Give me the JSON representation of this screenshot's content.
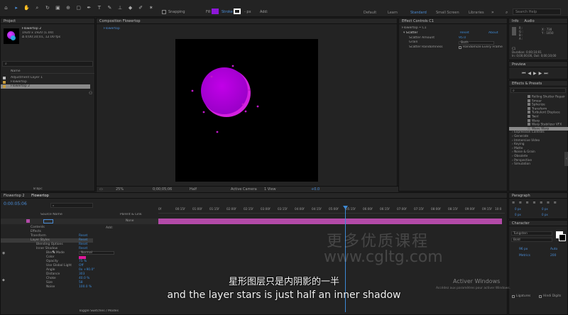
{
  "toolbar": {
    "snapping": "Snapping",
    "fill_label": "Fill",
    "stroke_label": "Stroke",
    "stroke_px": "- px",
    "add_label": "Add:",
    "workspaces": [
      "Default",
      "Learn",
      "Standard",
      "Small Screen",
      "Libraries"
    ],
    "search_placeholder": "Search Help"
  },
  "project": {
    "title": "Project",
    "thumb_name": "Flowertop 2",
    "thumb_info1": "1920 x 1920 (1.00)",
    "thumb_info2": "Δ 0;00;10;01, 12.00 fps",
    "col_name": "Name",
    "items": [
      "Adjustment Layer 1",
      "Flowertop",
      "Flowertop 2"
    ],
    "bpc": "8 bpc"
  },
  "composition": {
    "tab_title": "Composition Flowertop",
    "breadcrumb": "Flowertop",
    "zoom": "25%",
    "timecode": "0;00;05;06",
    "resolution": "Half",
    "camera": "Active Camera",
    "views": "1 View",
    "exposure": "+0.0"
  },
  "effect_controls": {
    "title": "Effect Controls C1",
    "layer": "Flowertop • C1",
    "fx_name": "Scatter",
    "reset": "Reset",
    "about": "About",
    "params": [
      {
        "label": "Scatter Amount",
        "value": "95.0"
      },
      {
        "label": "Grain",
        "value": "Both"
      },
      {
        "label": "Scatter Randomness",
        "value": "Randomize Every Frame"
      }
    ]
  },
  "info": {
    "tabs": [
      "Info",
      "Audio"
    ],
    "rgb": [
      "R :",
      "G :",
      "B :",
      "A :"
    ],
    "xy": [
      "X : 730",
      "Y : 1050"
    ],
    "layer_name": "C1",
    "duration": "Duration: 0;00;10;01",
    "in": "In: 0;00;00;00, Out: 0;00;10;00"
  },
  "preview": {
    "title": "Preview"
  },
  "effects_presets": {
    "title": "Effects & Presets",
    "items": [
      "Rolling Shutter Repair",
      "Smear",
      "Spherize",
      "Transform",
      "Turbulent Displace",
      "Twirl",
      "Warp",
      "Warp Stabilizer VFX",
      "Wave Warp"
    ],
    "categories": [
      "Expression Controls",
      "Generate",
      "Immersive Video",
      "Keying",
      "Matte",
      "Noise & Grain",
      "Obsolete",
      "Perspective",
      "Simulation"
    ]
  },
  "timeline": {
    "tabs": [
      "Flowertop 2",
      "Flowertop"
    ],
    "timecode": "0:00:05:06",
    "cols": [
      "Source Name",
      "Parent & Link"
    ],
    "parent_value": "None",
    "ruler_labels": [
      "0f",
      "00:15f",
      "01:00f",
      "01:15f",
      "02:00f",
      "02:15f",
      "03:00f",
      "03:15f",
      "04:00f",
      "04:15f",
      "05:00f",
      "05:15f",
      "06:00f",
      "06:15f",
      "07:00f",
      "07:15f",
      "08:00f",
      "08:15f",
      "09:00f",
      "09:15f",
      "10:0"
    ],
    "rows": [
      {
        "label": "Contents",
        "value": ""
      },
      {
        "label": "Effects",
        "value": ""
      },
      {
        "label": "Transform",
        "value": "Reset"
      },
      {
        "label": "Layer Styles",
        "value": "Reset"
      },
      {
        "label": "Blending Options",
        "value": "Reset"
      },
      {
        "label": "Inner Shadow",
        "value": "Reset"
      },
      {
        "label": "Blend Mode",
        "value": "Normal"
      },
      {
        "label": "Color",
        "value": ""
      },
      {
        "label": "Opacity",
        "value": "75 %"
      },
      {
        "label": "Use Global Light",
        "value": "Off"
      },
      {
        "label": "Angle",
        "value": "0x +90.0°"
      },
      {
        "label": "Distance",
        "value": "303"
      },
      {
        "label": "Choke",
        "value": "40.0 %"
      },
      {
        "label": "Size",
        "value": "58"
      },
      {
        "label": "Noise",
        "value": "100.0 %"
      }
    ],
    "add_label": "Add:",
    "footer": "Toggle Switches / Modes"
  },
  "paragraph": {
    "title": "Paragraph",
    "values": [
      "0 px",
      "0 px",
      "0 px",
      "0 px",
      "0 px"
    ]
  },
  "character": {
    "title": "Character",
    "font": "Tungsten",
    "style": "Bold",
    "size": "96 px",
    "leading": "Auto",
    "kerning": "Metrics",
    "tracking": "200",
    "ligatures": "Ligatures",
    "hindi": "Hindi Digits"
  },
  "colors": {
    "accent": "#5a2bd6",
    "selection_blue": "#3d8ad6",
    "layer_bar": "#b34aa8",
    "color_swatch": "#e0189a",
    "circle_fill": "#a400c8",
    "circle_fill_light": "#d21ce8"
  },
  "watermark": {
    "cn": "更多优质课程",
    "url": "www.cgltg.com"
  },
  "activation": {
    "title": "Activer Windows",
    "sub": "Accédez aux paramètres pour activer Windows."
  },
  "subtitles": {
    "cn": "星形图层只是内阴影的一半",
    "en": "and the layer stars is just half an inner shadow"
  }
}
